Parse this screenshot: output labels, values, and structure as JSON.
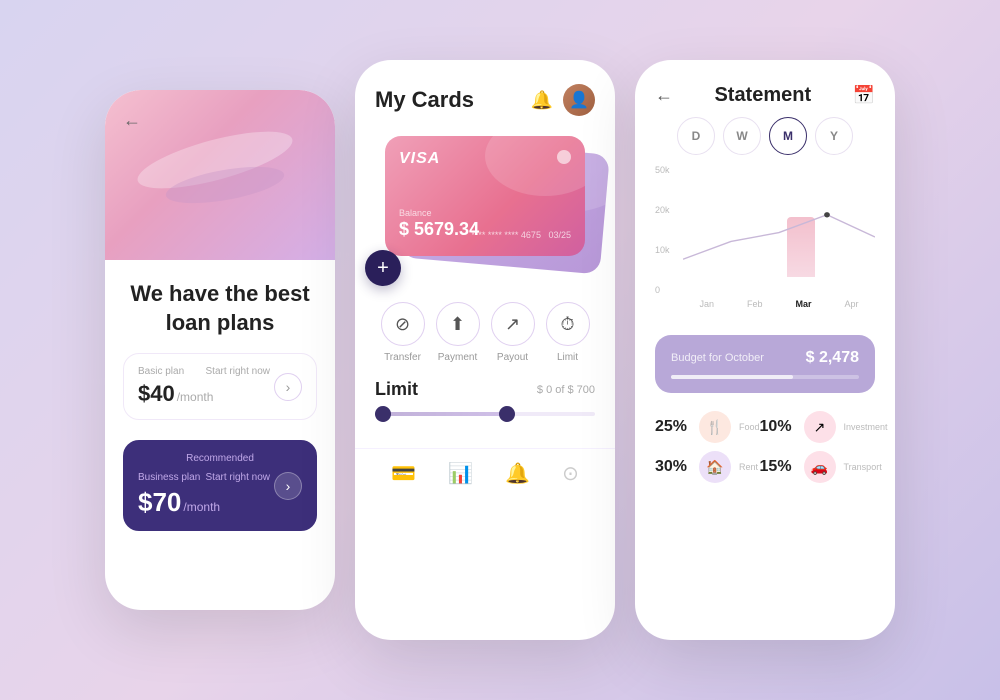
{
  "phone1": {
    "back": "←",
    "headline": "We have the best loan plans",
    "basic_plan": {
      "label": "Basic plan",
      "start": "Start right now",
      "price": "$40",
      "period": "/month"
    },
    "recommended_badge": "Recommended",
    "business_plan": {
      "label": "Business plan",
      "start": "Start right now",
      "price": "$70",
      "period": "/month"
    }
  },
  "phone2": {
    "title": "My Cards",
    "card": {
      "type": "VISA",
      "balance_label": "Balance",
      "balance": "$ 5679.34",
      "number": "**** **** **** 4675",
      "expiry": "03/25"
    },
    "add_button": "+",
    "actions": [
      {
        "icon": "⊘",
        "label": "Transfer"
      },
      {
        "icon": "↑",
        "label": "Payment"
      },
      {
        "icon": "$↗",
        "label": "Payout"
      },
      {
        "icon": "⏱",
        "label": "Limit"
      }
    ],
    "limit_title": "Limit",
    "limit_range": "$ 0 of $ 700",
    "footer_icons": [
      "💳",
      "📊",
      "🔔",
      "⊙"
    ]
  },
  "phone3": {
    "back": "←",
    "title": "Statement",
    "period_tabs": [
      "D",
      "W",
      "M",
      "Y"
    ],
    "active_tab": "M",
    "chart": {
      "y_labels": [
        "50k",
        "20k",
        "10k",
        "0"
      ],
      "x_labels": [
        "Jan",
        "Feb",
        "Mar",
        "Apr"
      ],
      "active_x": "Mar",
      "bar_month": "Mar",
      "dot_month": "Mar"
    },
    "budget": {
      "label": "Budget for October",
      "amount": "$ 2,478"
    },
    "stats": [
      {
        "pct": "25%",
        "name": "Food",
        "icon": "🍴",
        "color": "peach"
      },
      {
        "pct": "10%",
        "name": "Investment",
        "icon": "$↗",
        "color": "pink"
      },
      {
        "pct": "30%",
        "name": "Rent",
        "icon": "🏠",
        "color": "lavender"
      },
      {
        "pct": "15%",
        "name": "Transport",
        "icon": "🚗",
        "color": "pink"
      }
    ]
  }
}
